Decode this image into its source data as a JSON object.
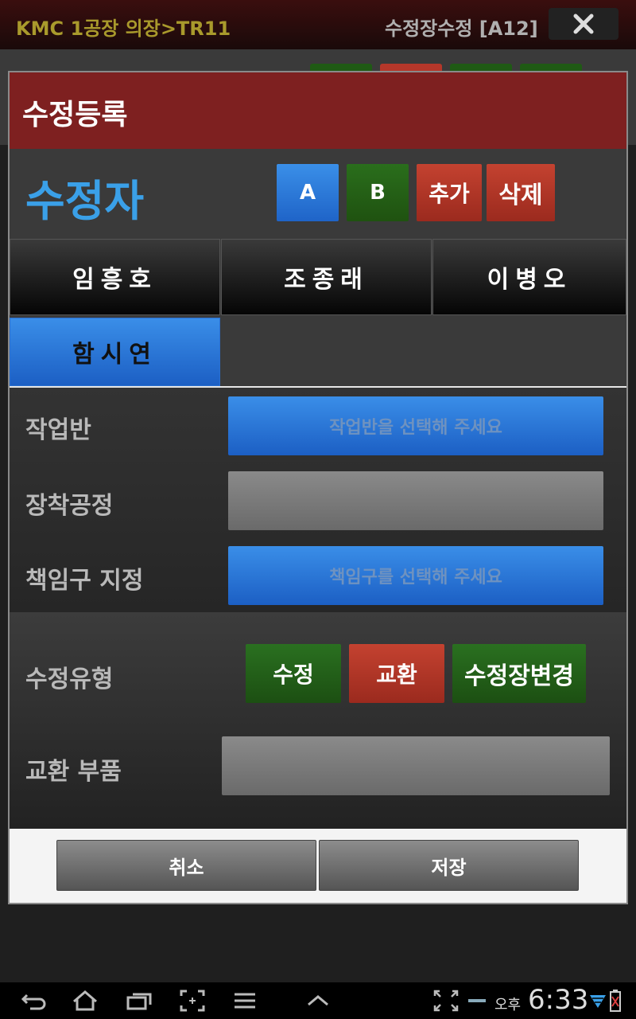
{
  "topbar": {
    "left_title": "KMC 1공장 의장>TR11",
    "right_title": "수정장수정 [A12]",
    "close_icon": "close-icon"
  },
  "dialog": {
    "title": "수정등록",
    "editor_label": "수정자",
    "editor_buttons": {
      "a": "A",
      "b": "B",
      "add": "추가",
      "delete": "삭제"
    },
    "editors": [
      {
        "name": "임흥호",
        "selected": false
      },
      {
        "name": "조종래",
        "selected": false
      },
      {
        "name": "이병오",
        "selected": false
      },
      {
        "name": "함시연",
        "selected": true
      }
    ],
    "form": {
      "work_team_label": "작업반",
      "work_team_placeholder": "작업반을 선택해 주세요",
      "process_label": "장착공정",
      "process_value": "",
      "responsible_label": "책임구 지정",
      "responsible_placeholder": "책임구를 선택해 주세요"
    },
    "repair_type": {
      "label": "수정유형",
      "options": {
        "edit": "수정",
        "swap": "교환",
        "change": "수정장변경"
      }
    },
    "swap_part": {
      "label": "교환 부품",
      "value": ""
    },
    "footer": {
      "cancel": "취소",
      "save": "저장"
    }
  },
  "statusbar": {
    "ampm": "오후",
    "time": "6:33"
  },
  "colors": {
    "header": "#7e2020",
    "blue": "#2f7fe0",
    "green": "#1f5a14",
    "red": "#b5372a",
    "editor_label": "#3aa0e8"
  }
}
